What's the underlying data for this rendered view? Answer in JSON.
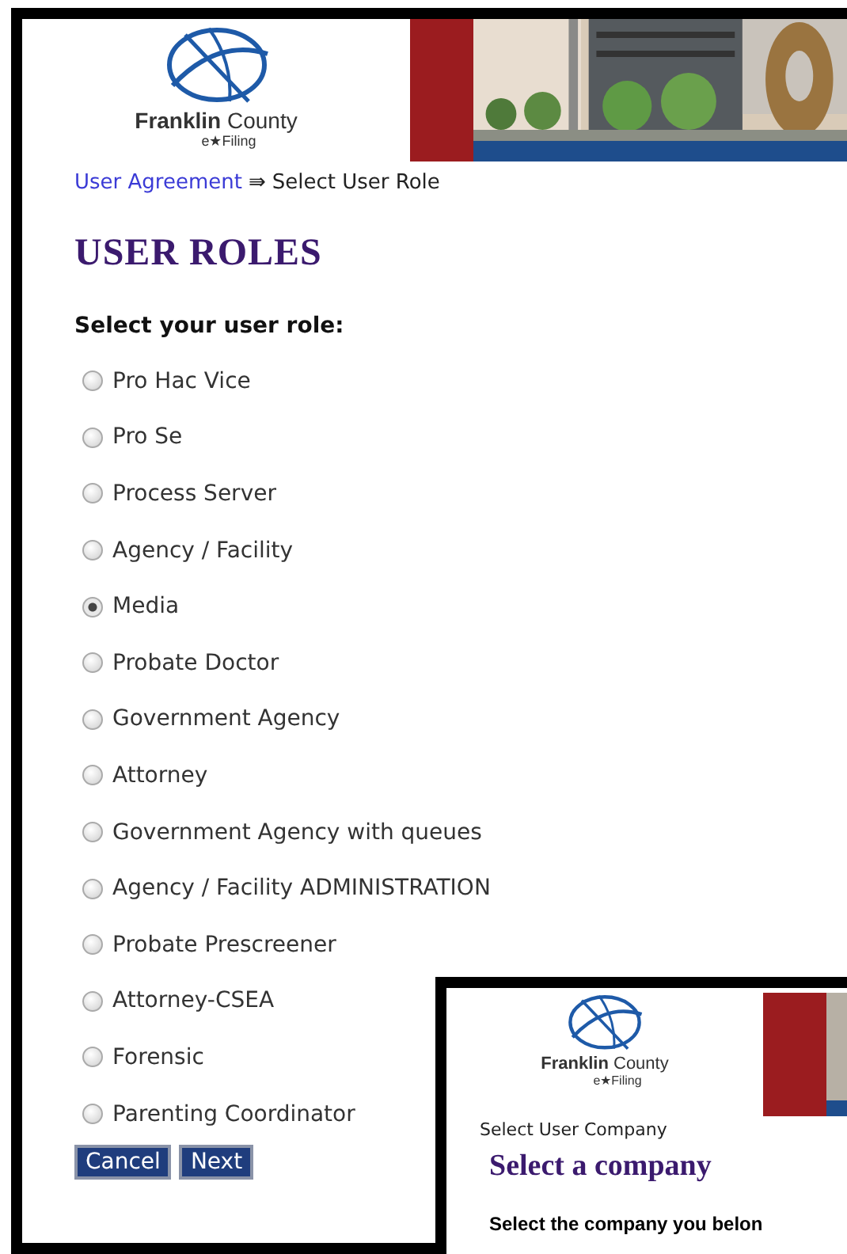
{
  "logo": {
    "name": "**Franklin** County",
    "sub": "e★Filing"
  },
  "breadcrumb": {
    "link": "User Agreement",
    "separator": "⇛",
    "current": "Select User Role"
  },
  "title": "USER ROLES",
  "prompt": "Select your user role:",
  "roles": [
    {
      "label": "Pro Hac Vice",
      "selected": false
    },
    {
      "label": "Pro Se",
      "selected": false
    },
    {
      "label": "Process Server",
      "selected": false
    },
    {
      "label": "Agency / Facility",
      "selected": false
    },
    {
      "label": "Media",
      "selected": true
    },
    {
      "label": "Probate Doctor",
      "selected": false
    },
    {
      "label": "Government Agency",
      "selected": false
    },
    {
      "label": "Attorney",
      "selected": false
    },
    {
      "label": "Government Agency with queues",
      "selected": false
    },
    {
      "label": "Agency / Facility ADMINISTRATION",
      "selected": false
    },
    {
      "label": "Probate Prescreener",
      "selected": false
    },
    {
      "label": "Attorney-CSEA",
      "selected": false
    },
    {
      "label": "Forensic",
      "selected": false
    },
    {
      "label": "Parenting Coordinator",
      "selected": false
    }
  ],
  "buttons": [
    "Cancel",
    "Next"
  ],
  "inset": {
    "logo": {
      "name": "**Franklin** County",
      "sub": "e★Filing"
    },
    "breadcrumb": "Select User Company",
    "title": "Select a company",
    "prompt": "Select the company you belon"
  }
}
